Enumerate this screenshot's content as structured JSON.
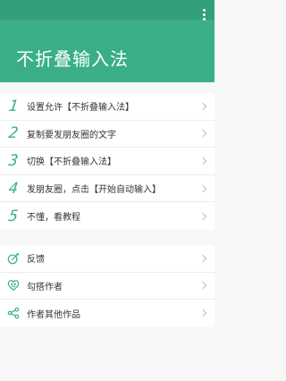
{
  "app": {
    "title": "不折叠输入法",
    "accent_color": "#3aaf85",
    "status_bar_color": "#33a07a"
  },
  "steps": [
    {
      "number": "1",
      "label": "设置允许【不折叠输入法】"
    },
    {
      "number": "2",
      "label": "复制要发朋友圈的文字"
    },
    {
      "number": "3",
      "label": "切换【不折叠输入法】"
    },
    {
      "number": "4",
      "label": "发朋友圈，点击【开始自动输入】"
    },
    {
      "number": "5",
      "label": "不懂，看教程"
    }
  ],
  "more": [
    {
      "icon": "feedback-pen-icon",
      "label": "反馈"
    },
    {
      "icon": "heart-face-icon",
      "label": "勾搭作者"
    },
    {
      "icon": "share-icon",
      "label": "作者其他作品"
    }
  ]
}
